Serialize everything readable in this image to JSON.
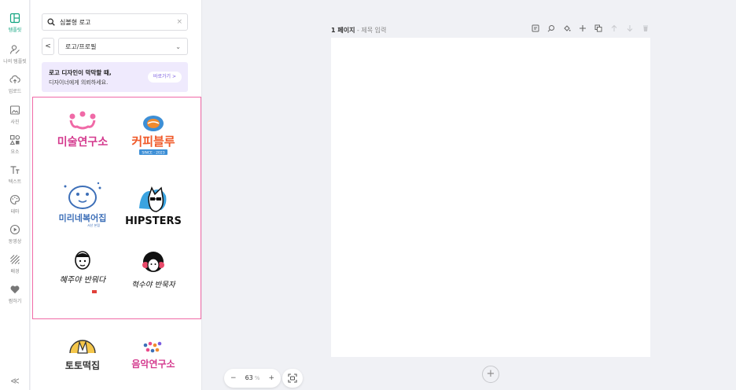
{
  "rail": {
    "items": [
      {
        "label": "템플릿",
        "icon": "layout-icon",
        "active": true
      },
      {
        "label": "나의 템플릿",
        "icon": "user-icon",
        "active": false
      },
      {
        "label": "업로드",
        "icon": "cloud-upload-icon",
        "active": false
      },
      {
        "label": "사진",
        "icon": "image-icon",
        "active": false
      },
      {
        "label": "요소",
        "icon": "shapes-icon",
        "active": false
      },
      {
        "label": "텍스트",
        "icon": "text-icon",
        "active": false
      },
      {
        "label": "테마",
        "icon": "palette-icon",
        "active": false
      },
      {
        "label": "동영상",
        "icon": "play-icon",
        "active": false
      },
      {
        "label": "배경",
        "icon": "stripes-icon",
        "active": false
      },
      {
        "label": "찜하기",
        "icon": "heart-icon",
        "active": false
      }
    ],
    "collapse": "≪"
  },
  "panel": {
    "search_value": "심볼형 로고",
    "search_clear": "×",
    "back": "<",
    "category": "로고/프로필",
    "promo": {
      "line1": "로고 디자인이 막막할 때,",
      "line2": "디자이너에게 의뢰하세요.",
      "button": "바로가기 >"
    },
    "logos": [
      {
        "name": "미술연구소",
        "icon": "crown-icon"
      },
      {
        "name": "커피블루",
        "sub": "SINCE · 2023",
        "icon": "coffee-bean-icon"
      },
      {
        "name": "미리네복어집",
        "sub": "서산 본점",
        "icon": "pufferfish-icon"
      },
      {
        "name": "HIPSTERS",
        "icon": "cat-sunglasses-icon"
      },
      {
        "name": "혜주야 반뭐다",
        "icon": "face-icon"
      },
      {
        "name": "혁수야 반묵자",
        "icon": "curly-face-icon"
      },
      {
        "name": "토토떡집",
        "icon": "rabbit-moon-icon"
      },
      {
        "name": "음악연구소",
        "icon": "dots-icon"
      }
    ]
  },
  "canvas": {
    "page_number": "1 페이지",
    "separator": " - ",
    "page_title": "제목 입력",
    "zoom_value": "63",
    "zoom_unit": "%",
    "zoom_minus": "−",
    "zoom_plus": "+",
    "add_page": "+"
  },
  "colors": {
    "accent": "#10a37f",
    "selection": "#f06aa7",
    "promo_bg": "#efeafd",
    "promo_button": "#7b5ce0"
  }
}
